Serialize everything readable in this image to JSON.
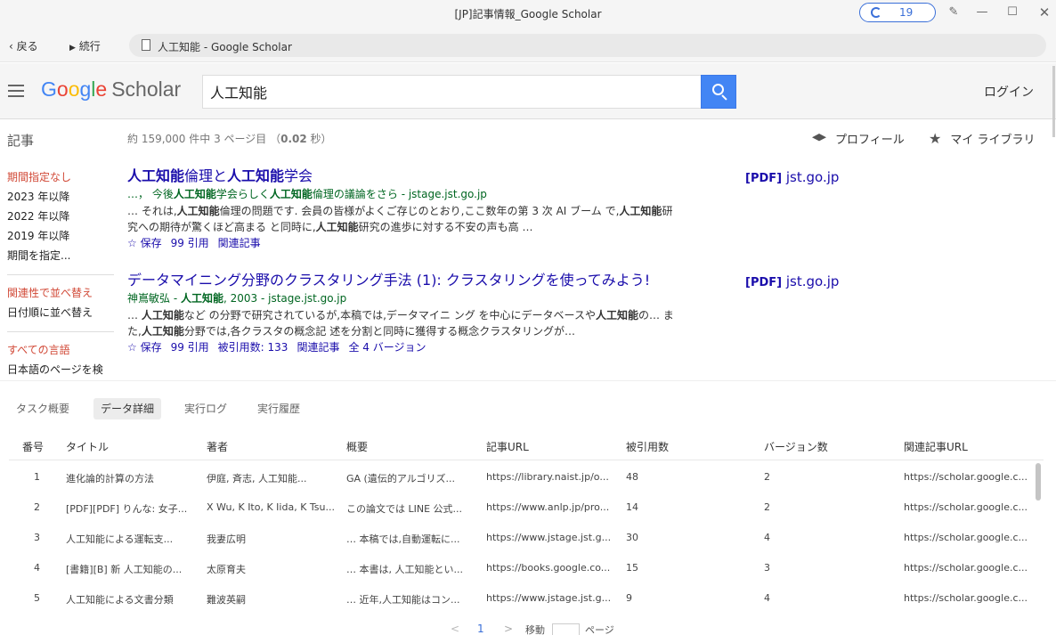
{
  "window": {
    "title": "[JP]記事情報_Google Scholar",
    "counter": "19"
  },
  "nav": {
    "back": "戻る",
    "forward": "続行",
    "address": "人工知能 - Google Scholar"
  },
  "header": {
    "logo_letters": [
      "G",
      "o",
      "o",
      "g",
      "l",
      "e"
    ],
    "logo_scholar": "Scholar",
    "search_value": "人工知能",
    "login": "ログイン"
  },
  "stats": {
    "section": "記事",
    "count_prefix": "約 159,000 件中 3 ページ目 （",
    "count_time": "0.02",
    "count_suffix": " 秒）",
    "profile": "プロフィール",
    "library": "マイ ライブラリ"
  },
  "filters": {
    "time": [
      "期間指定なし",
      "2023 年以降",
      "2022 年以降",
      "2019 年以降",
      "期間を指定..."
    ],
    "sort": [
      "関連性で並べ替え",
      "日付順に並べ替え"
    ],
    "lang": [
      "すべての言語",
      "日本語のページを検"
    ]
  },
  "results": [
    {
      "title_parts": [
        [
          "人工知能",
          true
        ],
        [
          "倫理と",
          false
        ],
        [
          "人工知能",
          true
        ],
        [
          "学会",
          false
        ]
      ],
      "meta_parts": [
        [
          "…， 今後",
          false
        ],
        [
          "人工知能",
          true
        ],
        [
          "学会らしく",
          false
        ],
        [
          "人工知能",
          true
        ],
        [
          "倫理の議論をさら - jstage.jst.go.jp",
          false
        ]
      ],
      "snippet_parts": [
        [
          "… それは,",
          false
        ],
        [
          "人工知能",
          true
        ],
        [
          "倫理の問題です. 会員の皆様がよくご存じのとおり,ここ数年の第 3 次 AI ブーム で,",
          false
        ],
        [
          "人工知能",
          true
        ],
        [
          "研究への期待が驚くほど高まる と同時に,",
          false
        ],
        [
          "人工知能",
          true
        ],
        [
          "研究の進歩に対する不安の声も高 …",
          false
        ]
      ],
      "actions": [
        "☆ 保存",
        "99 引用",
        "関連記事"
      ],
      "pdf_tag": "[PDF]",
      "pdf_site": "jst.go.jp"
    },
    {
      "title_parts": [
        [
          "データマイニング分野のクラスタリング手法 (1): クラスタリングを使ってみよう!",
          false
        ]
      ],
      "meta_parts": [
        [
          "神嶌敏弘 - ",
          false
        ],
        [
          "人工知能",
          true
        ],
        [
          ", 2003 - jstage.jst.go.jp",
          false
        ]
      ],
      "snippet_parts": [
        [
          "… ",
          false
        ],
        [
          "人工知能",
          true
        ],
        [
          "など の分野で研究されているが,本稿では,データマイニ ング を中心にデータベースや",
          false
        ],
        [
          "人工知能",
          true
        ],
        [
          "の… また,",
          false
        ],
        [
          "人工知能",
          true
        ],
        [
          "分野では,各クラスタの概念記 述を分割と同時に獲得する概念クラスタリングが…",
          false
        ]
      ],
      "actions": [
        "☆ 保存",
        "99 引用",
        "被引用数: 133",
        "関連記事",
        "全 4 バージョン"
      ],
      "pdf_tag": "[PDF]",
      "pdf_site": "jst.go.jp"
    }
  ],
  "panel": {
    "tabs": [
      "タスク概要",
      "データ詳細",
      "実行ログ",
      "実行履歴"
    ],
    "columns": [
      "番号",
      "タイトル",
      "著者",
      "概要",
      "記事URL",
      "被引用数",
      "バージョン数",
      "関連記事URL"
    ],
    "rows": [
      [
        "1",
        "進化論的計算の方法",
        "伊庭, 斉志, 人工知能...",
        "GA (遺伝的アルゴリズ...",
        "https://library.naist.jp/o...",
        "48",
        "2",
        "https://scholar.google.c..."
      ],
      [
        "2",
        "[PDF][PDF] りんな: 女子...",
        "X Wu, K Ito, K Iida, K Tsu...",
        "この論文では LINE 公式...",
        "https://www.anlp.jp/pro...",
        "14",
        "2",
        "https://scholar.google.c..."
      ],
      [
        "3",
        "人工知能による運転支...",
        "我妻広明",
        "… 本稿では,自動運転に...",
        "https://www.jstage.jst.g...",
        "30",
        "4",
        "https://scholar.google.c..."
      ],
      [
        "4",
        "[書籍][B] 新 人工知能の...",
        "太原育夫",
        "… 本書は, 人工知能とい...",
        "https://books.google.co...",
        "15",
        "3",
        "https://scholar.google.c..."
      ],
      [
        "5",
        "人工知能による文書分類",
        "難波英嗣",
        "… 近年,人工知能はコン...",
        "https://www.jstage.jst.g...",
        "9",
        "4",
        "https://scholar.google.c..."
      ]
    ]
  },
  "pager": {
    "prev": "<",
    "page": "1",
    "next": ">",
    "goto": "移動",
    "page_label": "ページ"
  },
  "colors": {
    "accent": "#4285f4",
    "link": "#1a0dab",
    "green": "#006621",
    "red": "#d14836"
  }
}
